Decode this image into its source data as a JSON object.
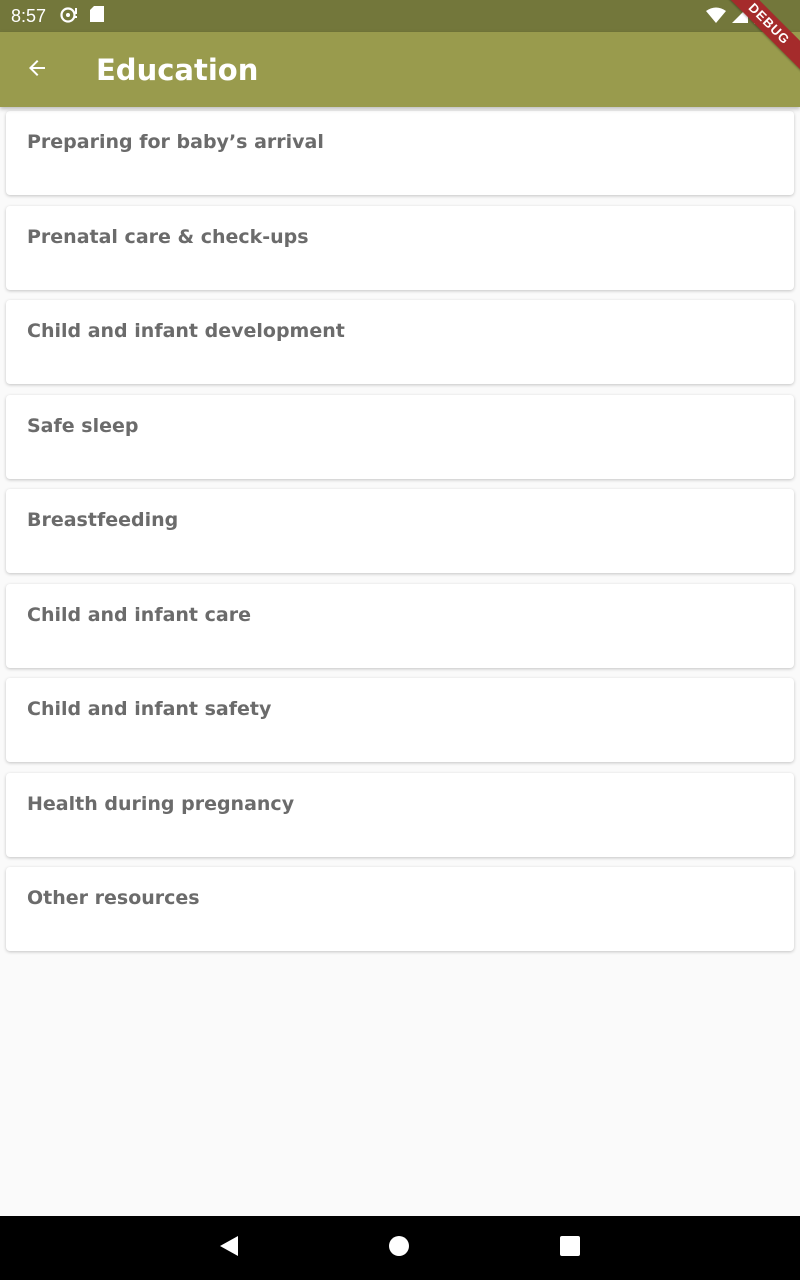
{
  "status_bar": {
    "time": "8:57",
    "icons": [
      "sync-icon",
      "sd-card-icon",
      "wifi-icon",
      "signal-icon",
      "battery-icon"
    ]
  },
  "debug_banner": "DEBUG",
  "app_bar": {
    "title": "Education",
    "back_icon": "arrow-back-icon",
    "color": "#999b4d"
  },
  "topics": [
    {
      "label": "Preparing for baby’s arrival"
    },
    {
      "label": "Prenatal care & check-ups"
    },
    {
      "label": "Child and infant development"
    },
    {
      "label": "Safe sleep"
    },
    {
      "label": "Breastfeeding"
    },
    {
      "label": "Child and infant care"
    },
    {
      "label": "Child and infant safety"
    },
    {
      "label": "Health during pregnancy"
    },
    {
      "label": "Other resources"
    }
  ],
  "nav_bar": {
    "icons": [
      "nav-back-icon",
      "nav-home-icon",
      "nav-recents-icon"
    ]
  },
  "colors": {
    "status_bar": "#73773b",
    "debug_ribbon": "#a52b2b",
    "card_text": "#6b6b6b",
    "background": "#fafafa"
  }
}
